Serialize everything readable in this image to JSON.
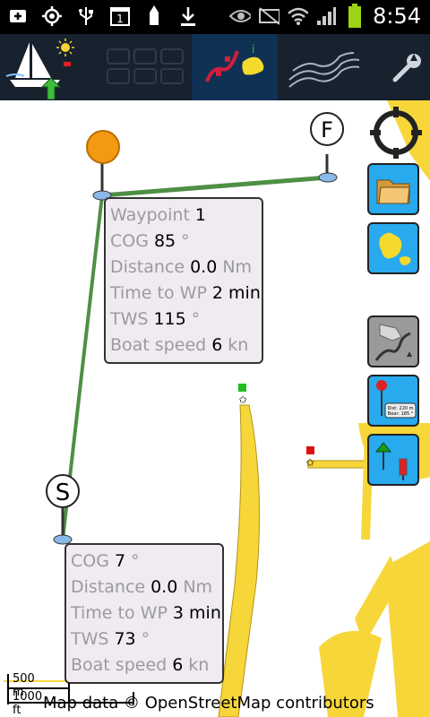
{
  "status_bar": {
    "time": "8:54",
    "icons": [
      "add-icon",
      "gps-icon",
      "usb-icon",
      "calendar-icon",
      "ship-icon",
      "download-icon",
      "eye-icon",
      "mute-icon",
      "wifi-icon",
      "signal-icon",
      "battery-icon"
    ],
    "calendar_day": "1"
  },
  "toolbar": {
    "buttons": [
      "sailboat-app-icon",
      "grid-icon",
      "route-map-icon",
      "contour-lines-icon",
      "wrench-icon"
    ],
    "route_info_glyph": "i"
  },
  "map": {
    "start_marker": "S",
    "finish_marker": "F",
    "waypoint_info": {
      "waypoint_label": "Waypoint",
      "waypoint_value": "1",
      "cog_label": "COG",
      "cog_value": "85",
      "cog_unit": "°",
      "distance_label": "Distance",
      "distance_value": "0.0",
      "distance_unit": "Nm",
      "time_label": "Time to WP",
      "time_value": "2 min",
      "tws_label": "TWS",
      "tws_value": "115",
      "tws_unit": "°",
      "speed_label": "Boat speed",
      "speed_value": "6",
      "speed_unit": "kn"
    },
    "start_info": {
      "cog_label": "COG",
      "cog_value": "7",
      "cog_unit": "°",
      "distance_label": "Distance",
      "distance_value": "0.0",
      "distance_unit": "Nm",
      "time_label": "Time to WP",
      "time_value": "3 min",
      "tws_label": "TWS",
      "tws_value": "73",
      "tws_unit": "°",
      "speed_label": "Boat speed",
      "speed_value": "6",
      "speed_unit": "kn"
    },
    "side_buttons": [
      "locate-icon",
      "folder-icon",
      "island-map-icon",
      "terrain-map-icon",
      "pin-info-icon",
      "buoy-marks-icon"
    ],
    "pin_card_line1": "Dist: 220 m",
    "pin_card_line2": "Bear: 185 °",
    "scale_top": "500 m",
    "scale_bottom": "1000 ft",
    "attribution": "Map data © OpenStreetMap contributors",
    "colors": {
      "route": "#4f8f45",
      "land": "#f7d63a",
      "button_blue": "#29a9ee",
      "waypoint_orange": "#f39a12"
    }
  }
}
